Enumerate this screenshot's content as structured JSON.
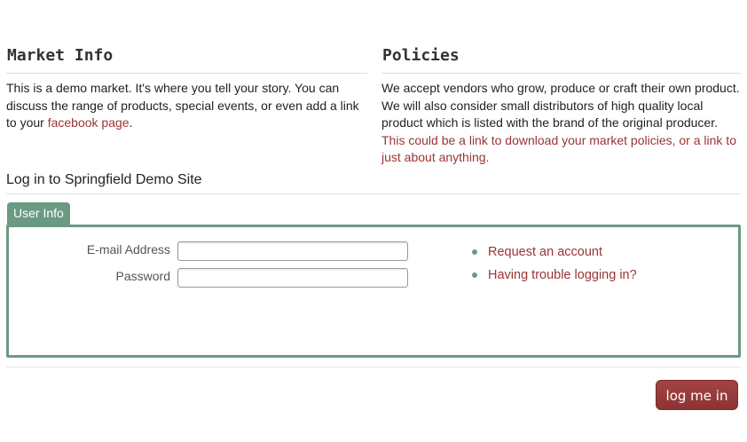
{
  "market_info": {
    "heading": "Market Info",
    "body_text": "This is a demo market. It's where you tell your story. You can discuss the range of products, special events, or even add a link to your ",
    "link_text": "facebook page",
    "body_suffix": "."
  },
  "policies": {
    "heading": "Policies",
    "body_text": "We accept vendors who grow, produce or craft their own product. We will also consider small distributors of high quality local product which is listed with the brand of the original producer. ",
    "link_text": "This could be a link to download your market policies, or a link to just about anything."
  },
  "login": {
    "title": "Log in to Springfield Demo Site",
    "tab_label": "User Info",
    "email_label": "E-mail Address",
    "email_value": "",
    "password_label": "Password",
    "password_value": "",
    "links": [
      "Request an account",
      "Having trouble logging in?"
    ],
    "submit_label": "log me in"
  },
  "colors": {
    "accent_green": "#6a9a83",
    "link_red": "#9b3434",
    "button_red": "#973a3a"
  }
}
